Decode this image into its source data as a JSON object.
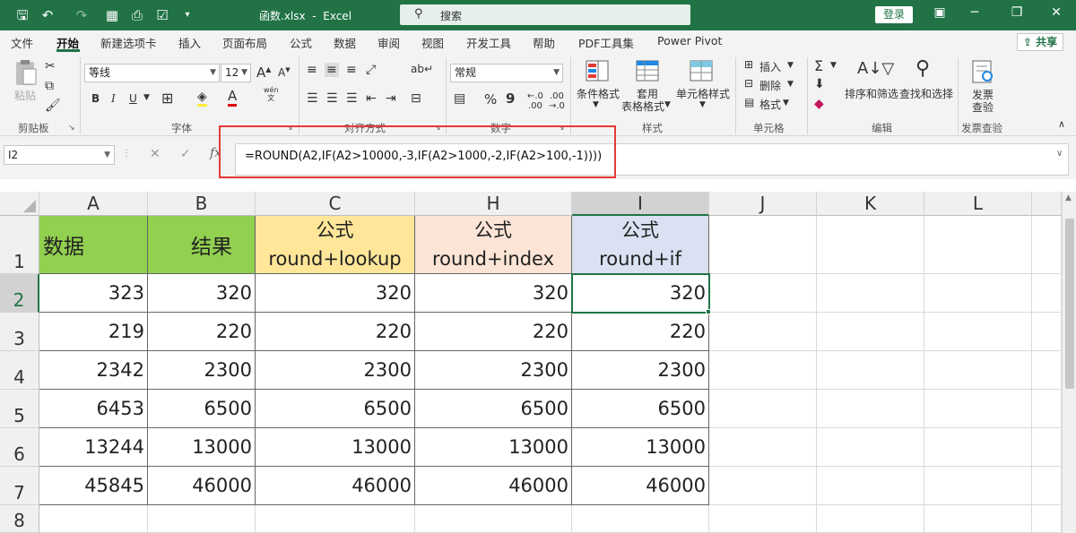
{
  "titlebar": {
    "filename": "函数.xlsx",
    "separator": "-",
    "app": "Excel",
    "search_placeholder": "搜索",
    "login": "登录"
  },
  "menu": {
    "items": [
      "文件",
      "开始",
      "新建选项卡",
      "插入",
      "页面布局",
      "公式",
      "数据",
      "审阅",
      "视图",
      "开发工具",
      "帮助",
      "PDF工具集",
      "Power Pivot"
    ],
    "active": "开始",
    "share": "共享"
  },
  "ribbon": {
    "clipboard": {
      "paste": "粘贴",
      "label": "剪贴板"
    },
    "font": {
      "name": "等线",
      "size": "12",
      "bold": "B",
      "italic": "I",
      "underline": "U",
      "label": "字体",
      "phonetic_top": "wén",
      "phonetic_bottom": "文"
    },
    "align": {
      "label": "对齐方式"
    },
    "number": {
      "format": "常规",
      "percent": "%",
      "comma": "9",
      "label": "数字"
    },
    "styles": {
      "conditional": "条件格式",
      "table": "套用",
      "table2": "表格格式",
      "cell": "单元格样式",
      "label": "样式"
    },
    "cells": {
      "insert": "插入",
      "delete": "删除",
      "format": "格式",
      "label": "单元格"
    },
    "editing": {
      "sigma": "Σ",
      "sort": "排序和筛选",
      "find": "查找和选择",
      "label": "编辑"
    },
    "check": {
      "check1": "发票",
      "check2": "查验",
      "label": "发票查验"
    }
  },
  "formula_bar": {
    "name_box": "I2",
    "fx": "fx",
    "formula": "=ROUND(A2,IF(A2>10000,-3,IF(A2>1000,-2,IF(A2>100,-1))))"
  },
  "sheet": {
    "columns": [
      "A",
      "B",
      "C",
      "H",
      "I",
      "J",
      "K",
      "L"
    ],
    "selected_column": "I",
    "rows": [
      "1",
      "2",
      "3",
      "4",
      "5",
      "6",
      "7",
      "8"
    ],
    "selected_row": "2",
    "header": {
      "a": "数据",
      "b": "结果",
      "c1": "公式",
      "c2": "round+lookup",
      "h1": "公式",
      "h2": "round+index",
      "i1": "公式",
      "i2": "round+if"
    },
    "data": [
      [
        "323",
        "320",
        "320",
        "320",
        "320"
      ],
      [
        "219",
        "220",
        "220",
        "220",
        "220"
      ],
      [
        "2342",
        "2300",
        "2300",
        "2300",
        "2300"
      ],
      [
        "6453",
        "6500",
        "6500",
        "6500",
        "6500"
      ],
      [
        "13244",
        "13000",
        "13000",
        "13000",
        "13000"
      ],
      [
        "45845",
        "46000",
        "46000",
        "46000",
        "46000"
      ]
    ]
  },
  "colors": {
    "excel_green": "#217346",
    "header_green": "#92d050",
    "header_yellow": "#ffe699",
    "header_peach": "#fce4d6",
    "header_blue": "#d9e1f2",
    "highlight_red": "#e53935"
  }
}
